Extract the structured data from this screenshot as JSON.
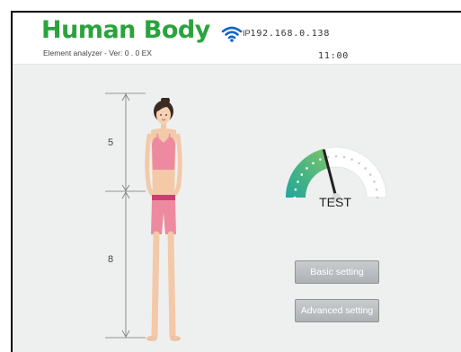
{
  "header": {
    "title": "Human Body",
    "subtitle": "Element analyzer - Ver: 0 . 0 EX",
    "ip_prefix": "IP",
    "ip_address": "192.168.0.138",
    "time": "11:00",
    "wifi_icon": "wifi-icon",
    "title_color": "#2aa33c"
  },
  "body_figure": {
    "upper_segment": "5",
    "lower_segment": "8",
    "figure_icon": "woman-figure"
  },
  "gauge": {
    "label": "TEST",
    "level": 0.42,
    "colors": {
      "fill_start": "#1ea79a",
      "fill_end": "#7cc36a",
      "needle": "#222222"
    }
  },
  "buttons": {
    "basic_setting": "Basic setting",
    "advanced_setting": "Advanced setting"
  }
}
